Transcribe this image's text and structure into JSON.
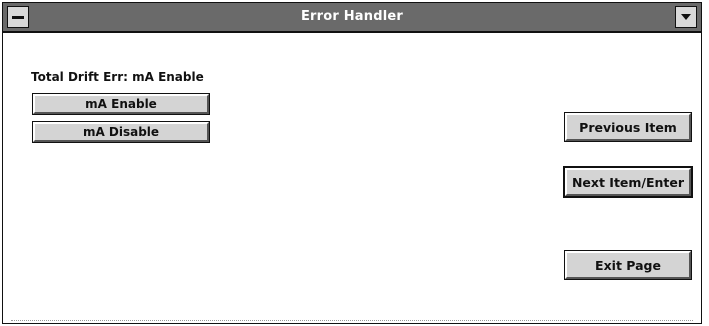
{
  "window": {
    "title": "Error Handler"
  },
  "titlebar": {
    "system_menu_icon": "minus-icon",
    "dropdown_icon": "triangle-down-icon"
  },
  "main": {
    "status_label": "Total Drift Err: mA Enable",
    "options": {
      "enable_label": "mA Enable",
      "disable_label": "mA Disable"
    }
  },
  "nav": {
    "previous": {
      "mnemonic": "P",
      "rest": "revious Item"
    },
    "next": {
      "mnemonic": "N",
      "rest": "ext Item/Enter"
    },
    "exit": {
      "pre": "E",
      "mnemonic": "x",
      "rest": "it Page"
    }
  },
  "colors": {
    "titlebar": "#6a6a6a",
    "button_face": "#d4d4d4",
    "background": "#ffffff"
  }
}
